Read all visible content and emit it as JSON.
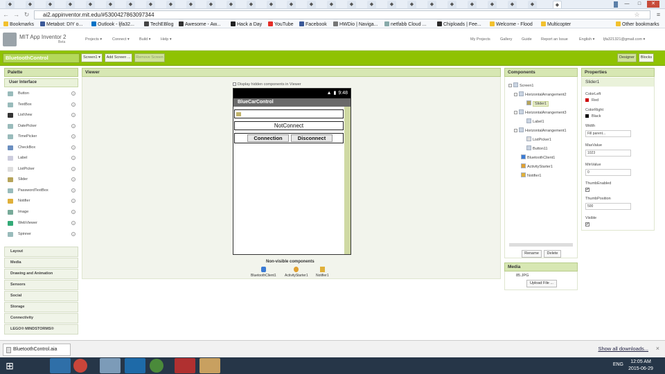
{
  "browser": {
    "window_button_labels": [
      "—",
      "□",
      "✕"
    ],
    "address": "ai2.appinventor.mit.edu/#5300427863097344",
    "bookmarks": [
      {
        "label": "Bookmarks",
        "color": "#f2c12e"
      },
      {
        "label": "Metabot: DIY o...",
        "color": "#3b5998"
      },
      {
        "label": "Outlook - ljfa32...",
        "color": "#0072c6"
      },
      {
        "label": "TechEBlog",
        "color": "#444444"
      },
      {
        "label": "Awesome - Aw...",
        "color": "#333333"
      },
      {
        "label": "Hack a Day",
        "color": "#222222"
      },
      {
        "label": "YouTube",
        "color": "#e52d27"
      },
      {
        "label": "Facebook",
        "color": "#3b5998"
      },
      {
        "label": "HWDio | Naviga...",
        "color": "#777777"
      },
      {
        "label": "netfabb Cloud ...",
        "color": "#8aa"
      },
      {
        "label": "Chiploads | Fee...",
        "color": "#2b2b2b"
      },
      {
        "label": "Welcome - Flood",
        "color": "#f2c12e"
      },
      {
        "label": "Multicopter",
        "color": "#f2c12e"
      },
      {
        "label": "Other bookmarks",
        "color": "#f2c12e"
      }
    ]
  },
  "header": {
    "app_name": "MIT App Inventor 2",
    "beta": "Beta",
    "menus": [
      "Projects ▾",
      "Connect ▾",
      "Build ▾",
      "Help ▾"
    ],
    "right_links": [
      "My Projects",
      "Gallery",
      "Guide",
      "Report an Issue",
      "English ▾",
      "ljfa321321@gmail.com ▾"
    ]
  },
  "toolbar": {
    "project": "BluetoothControl",
    "screen_select": "Screen1 ▾",
    "add_screen": "Add Screen ...",
    "remove_screen": "Remove Screen",
    "designer": "Designer",
    "blocks": "Blocks"
  },
  "palette": {
    "title": "Palette",
    "section": "User Interface",
    "items": [
      "Button",
      "TextBox",
      "ListView",
      "DatePicker",
      "TimePicker",
      "CheckBox",
      "Label",
      "ListPicker",
      "Slider",
      "PasswordTextBox",
      "Notifier",
      "Image",
      "WebViewer",
      "Spinner"
    ],
    "help": "?",
    "categories": [
      "Layout",
      "Media",
      "Drawing and Animation",
      "Sensors",
      "Social",
      "Storage",
      "Connectivity",
      "LEGO® MINDSTORMS®"
    ]
  },
  "viewer": {
    "title": "Viewer",
    "hidden_check": "Display hidden components in Viewer",
    "time": "9:48",
    "app_title": "BlueCarControl",
    "label_text": "NotConnect",
    "btn_connect": "Connection",
    "btn_disconnect": "Disconnect",
    "nonvisible_title": "Non-visible components",
    "nonvisible": [
      "BluetoothClient1",
      "ActivityStarter1",
      "Notifier1"
    ]
  },
  "components": {
    "title": "Components",
    "tree": [
      "Screen1",
      "HorizontalArrangement2",
      "Slider1",
      "HorizontalArrangement3",
      "Label1",
      "HorizontalArrangement1",
      "ListPicker1",
      "Button11",
      "BluetoothClient1",
      "ActivityStarter1",
      "Notifier1"
    ],
    "rename": "Rename",
    "delete": "Delete"
  },
  "media": {
    "title": "Media",
    "file": "85.JPG",
    "upload": "Upload File ..."
  },
  "properties": {
    "title": "Properties",
    "component": "Slider1",
    "color_left_label": "ColorLeft",
    "color_left": "Red",
    "color_left_hex": "#cc0000",
    "color_right_label": "ColorRight",
    "color_right": "Black",
    "color_right_hex": "#000000",
    "width_label": "Width",
    "width": "Fill parent...",
    "max_label": "MaxValue",
    "max": "1023",
    "min_label": "MinValue",
    "min": "0",
    "thumb_enabled_label": "ThumbEnabled",
    "thumb_pos_label": "ThumbPosition",
    "thumb_pos": "500",
    "visible_label": "Visible",
    "checkmark": "✔"
  },
  "downloads": {
    "file": "BluetoothControl.aia",
    "show_all": "Show all downloads..."
  },
  "taskbar": {
    "ime": "ENG",
    "time": "12:05 AM",
    "date": "2015-06-29"
  },
  "colors": {
    "accent_green": "#8fc202",
    "panel_head": "#d7e7b3"
  }
}
